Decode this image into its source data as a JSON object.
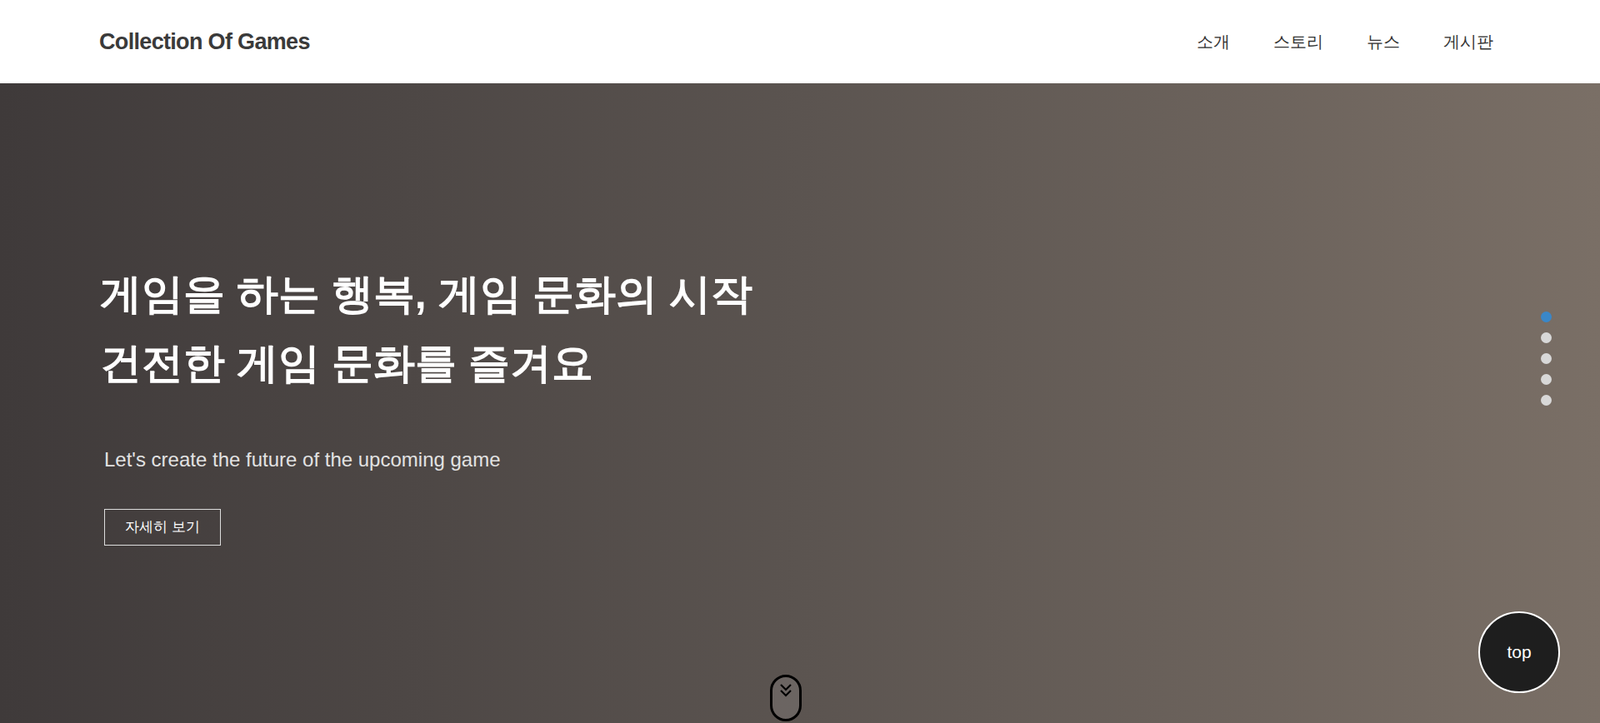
{
  "header": {
    "logo": "Collection Of Games",
    "nav": [
      {
        "label": "소개"
      },
      {
        "label": "스토리"
      },
      {
        "label": "뉴스"
      },
      {
        "label": "게시판"
      }
    ]
  },
  "hero": {
    "headline": [
      "게임을 하는 행복, 게임 문화의 시작",
      "건전한 게임 문화를 즐겨요"
    ],
    "subtitle": "Let's create the future of the upcoming game",
    "button": "자세히 보기"
  },
  "slider_dots": [
    {
      "selected": true
    },
    {
      "selected": false
    },
    {
      "selected": false
    },
    {
      "selected": false
    },
    {
      "selected": false
    }
  ],
  "top_button": "top"
}
